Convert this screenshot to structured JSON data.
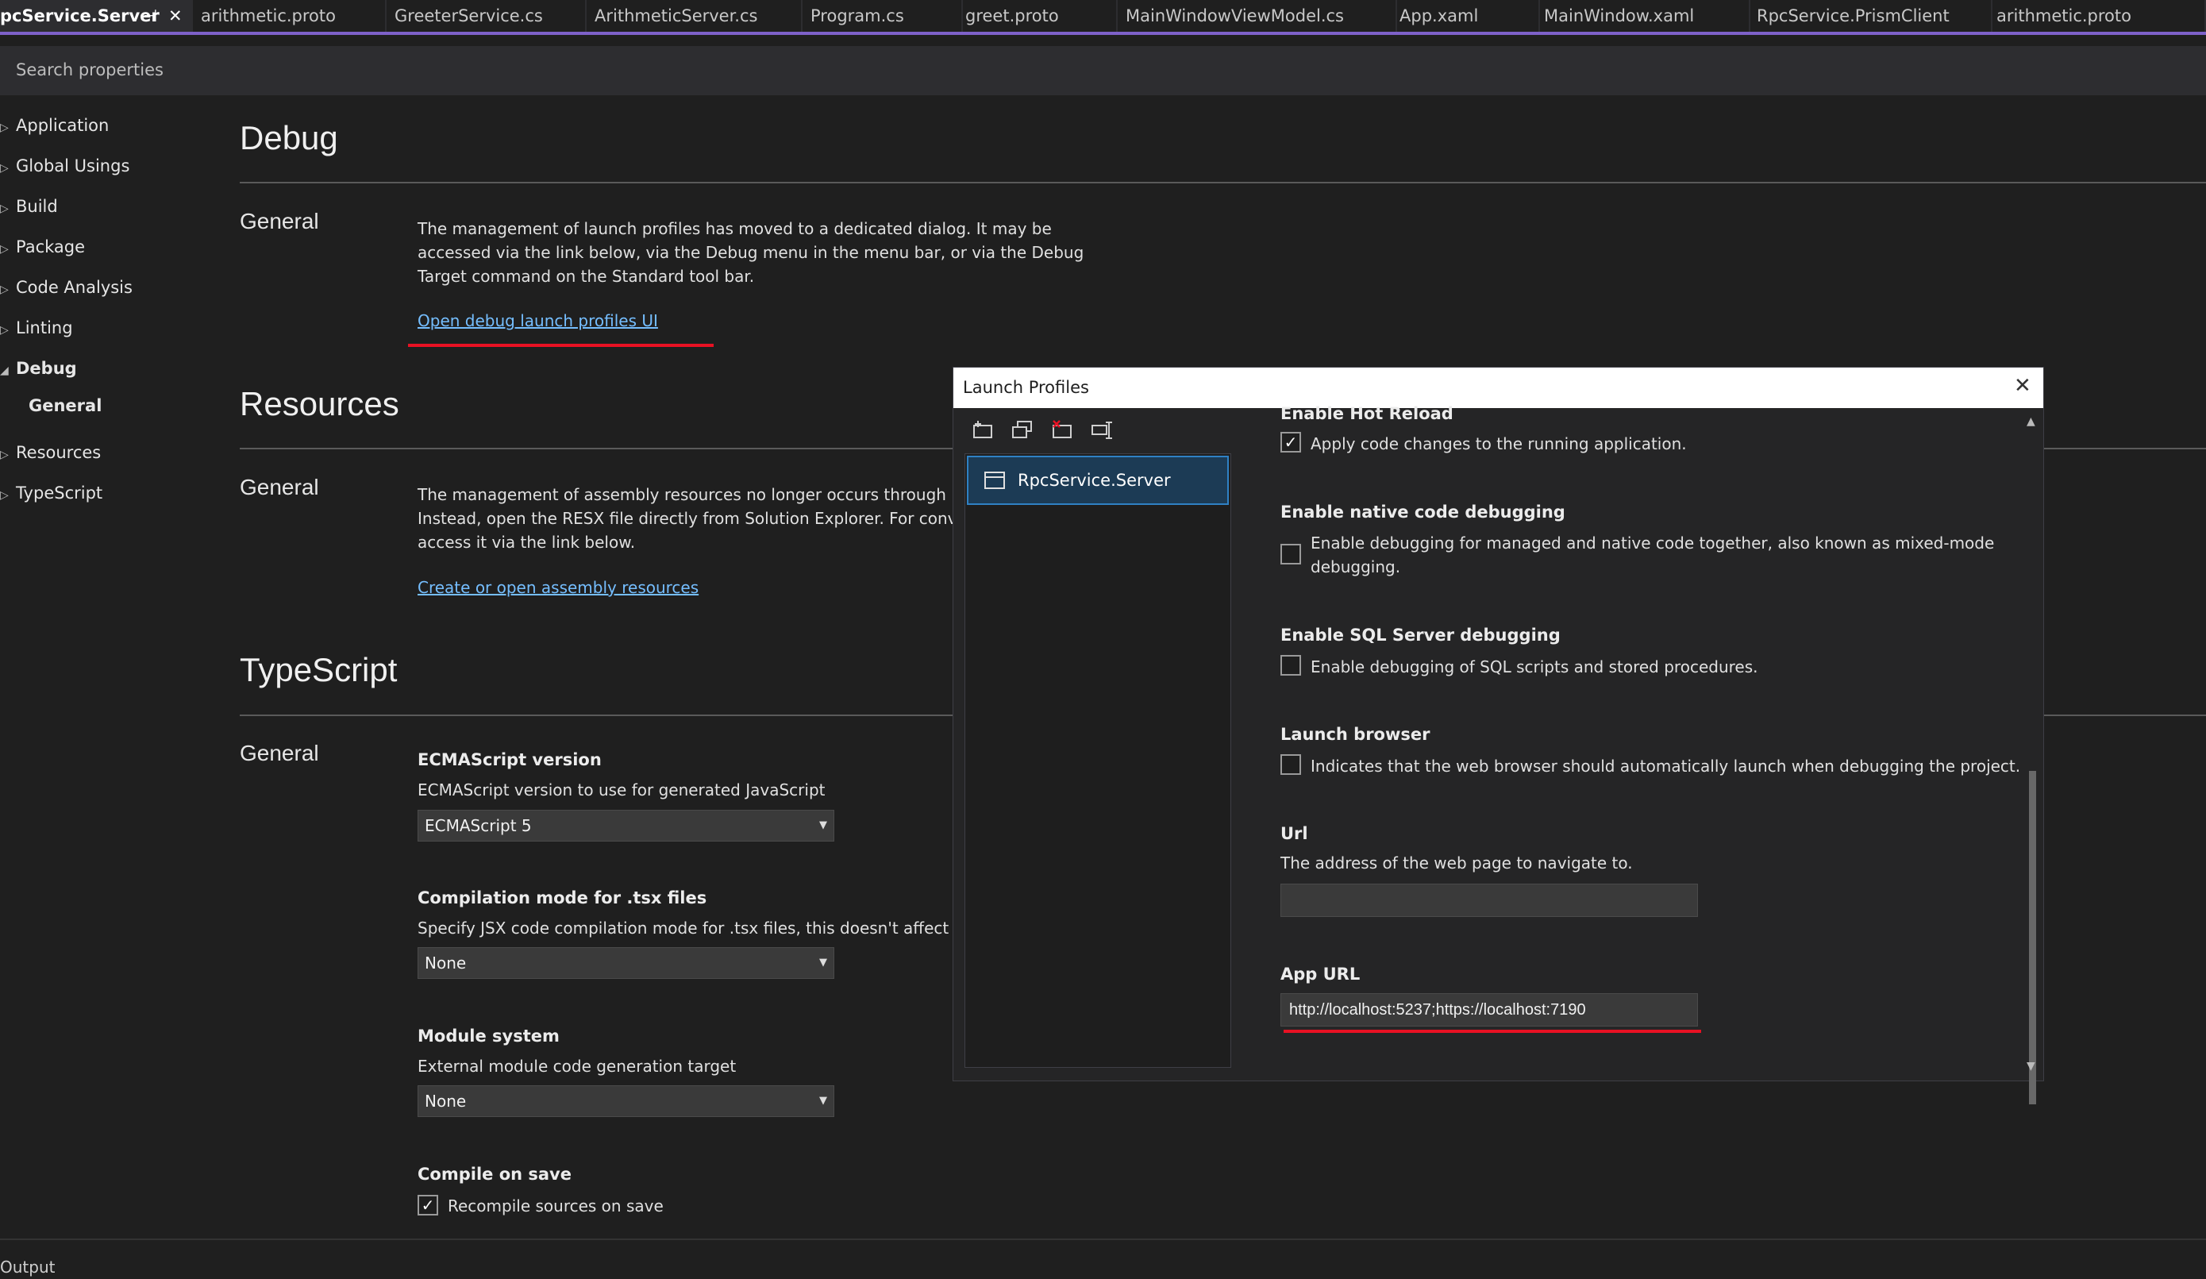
{
  "tabs": [
    {
      "label": "pcService.Server",
      "active": true
    },
    {
      "label": "arithmetic.proto"
    },
    {
      "label": "GreeterService.cs"
    },
    {
      "label": "ArithmeticServer.cs"
    },
    {
      "label": "Program.cs"
    },
    {
      "label": "greet.proto"
    },
    {
      "label": "MainWindowViewModel.cs"
    },
    {
      "label": "App.xaml"
    },
    {
      "label": "MainWindow.xaml"
    },
    {
      "label": "RpcService.PrismClient"
    },
    {
      "label": "arithmetic.proto"
    }
  ],
  "tab_icons": {
    "pin": "⊣",
    "close": "✕"
  },
  "search": {
    "placeholder": "Search properties"
  },
  "nav": [
    {
      "label": "Application"
    },
    {
      "label": "Global Usings"
    },
    {
      "label": "Build"
    },
    {
      "label": "Package"
    },
    {
      "label": "Code Analysis"
    },
    {
      "label": "Linting"
    },
    {
      "label": "Debug",
      "expanded": true
    },
    {
      "label": "General",
      "child": true
    },
    {
      "label": "Resources"
    },
    {
      "label": "TypeScript"
    }
  ],
  "debug": {
    "heading": "Debug",
    "section": "General",
    "text": "The management of launch profiles has moved to a dedicated dialog. It may be accessed via the link below, via the Debug menu in the menu bar, or via the Debug Target command on the Standard tool bar.",
    "link": "Open debug launch profiles UI"
  },
  "resources": {
    "heading": "Resources",
    "section": "General",
    "text": "The management of assembly resources no longer occurs through proj Instead, open the RESX file directly from Solution Explorer. For conveni access it via the link below.",
    "line1": "The management of assembly resources no longer occurs through proj",
    "line2": "Instead, open the RESX file directly from Solution Explorer. For conveni",
    "line3": "access it via the link below.",
    "link": "Create or open assembly resources"
  },
  "typescript": {
    "heading": "TypeScript",
    "section": "General",
    "ecma_label": "ECMAScript version",
    "ecma_desc": "ECMAScript version to use for generated JavaScript",
    "ecma_value": "ECMAScript 5",
    "tsx_label": "Compilation mode for .tsx files",
    "tsx_desc": "Specify JSX code compilation mode for .tsx files, this doesn't affect .ts",
    "tsx_value": "None",
    "module_label": "Module system",
    "module_desc": "External module code generation target",
    "module_value": "None",
    "compile_label": "Compile on save",
    "compile_desc": "Recompile sources on save",
    "compile_checked": true
  },
  "dialog": {
    "title": "Launch Profiles",
    "close": "✕",
    "toolbar_icons": [
      "new-profile-icon",
      "duplicate-profile-icon",
      "delete-profile-icon",
      "rename-profile-icon"
    ],
    "profile": "RpcService.Server",
    "hot_reload_label": "Enable Hot Reload",
    "hot_reload_desc": "Apply code changes to the running application.",
    "hot_reload_checked": true,
    "native_label": "Enable native code debugging",
    "native_desc1": "Enable debugging for managed and native code together, also known as mixed-mode",
    "native_desc2": "debugging.",
    "sql_label": "Enable SQL Server debugging",
    "sql_desc": "Enable debugging of SQL scripts and stored procedures.",
    "browser_label": "Launch browser",
    "browser_desc": "Indicates that the web browser should automatically launch when debugging the project.",
    "url_label": "Url",
    "url_desc": "The address of the web page to navigate to.",
    "url_value": "",
    "appurl_label": "App URL",
    "appurl_value": "http://localhost:5237;https://localhost:7190"
  },
  "footer": {
    "label": "Output"
  },
  "colors": {
    "accent": "#7e61c9",
    "link": "#75beff",
    "annotation": "#e81123",
    "selection": "#1c3b55"
  }
}
